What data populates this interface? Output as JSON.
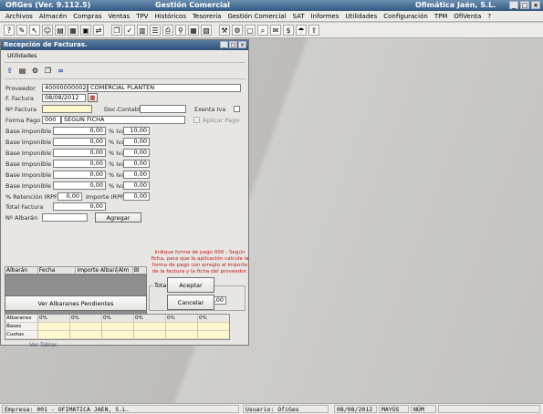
{
  "app": {
    "title": "OfiGes (Ver. 9.112.5)",
    "module": "Gestión Comercial",
    "company": "Ofimática Jaén, S.L."
  },
  "menu": [
    "Archivos",
    "Almacén",
    "Compras",
    "Ventas",
    "TPV",
    "Históricos",
    "Tesorería",
    "Gestión Comercial",
    "SAT",
    "Informes",
    "Utilidades",
    "Configuración",
    "TPM",
    "OfiVenta",
    "?"
  ],
  "toolbar_icons": [
    "help-icon",
    "edit-icon",
    "pointer-icon",
    "users-icon",
    "document-icon",
    "table-icon",
    "grid-icon",
    "exchange-icon",
    "copy-icon",
    "check-icon",
    "chart-icon",
    "list-icon",
    "print-icon",
    "filter-icon",
    "calendar-icon",
    "image-icon",
    "tool-icon",
    "gear-icon",
    "window-icon",
    "search-icon",
    "note-icon",
    "cash-icon",
    "umbrella-icon",
    "export-icon"
  ],
  "window": {
    "title": "Recepción de Facturas.",
    "menu": "Utilidades",
    "labels": {
      "proveedor": "Proveedor",
      "f_factura": "F. Factura",
      "n_factura": "Nº Factura",
      "doc_contable": "Doc.Contable",
      "exenta_iva": "Exenta Iva",
      "forma_pago": "Forma Pago",
      "aplicar_pago": "Aplicar Pago",
      "base1": "Base Imponible 1",
      "base2": "Base Imponible 2",
      "base3": "Base Imponible 3",
      "base4": "Base Imponible 4",
      "base5": "Base Imponible 5",
      "base6": "Base Imponible 6",
      "pct_iva": "% Iva",
      "retencion": "% Retención IRPF",
      "importe_irpf": "Importe IRPF",
      "total_factura": "Total Factura",
      "n_albaran": "Nº Albarán",
      "total_albaranes": "Total Albaranes"
    },
    "values": {
      "proveedor_code": "40000000002",
      "proveedor_name": "COMERCIAL PLANTEN",
      "f_factura": "08/08/2012",
      "n_factura": "",
      "doc_contable": "",
      "forma_pago_code": "000",
      "forma_pago_name": "SEGUN FICHA",
      "bases": [
        "0,00",
        "0,00",
        "0,00",
        "0,00",
        "0,00",
        "0,00"
      ],
      "ivas": [
        "10,00",
        "0,00",
        "0,00",
        "0,00",
        "0,00",
        "0,00"
      ],
      "retencion": "0,00",
      "importe_irpf": "0,00",
      "total_factura": "0,00",
      "n_albaran": "",
      "total_albaranes": "0,00"
    },
    "buttons": {
      "agregar": "Agregar",
      "ver_albaranes": "Ver Albaranes Pendientes",
      "aceptar": "Aceptar",
      "cancelar": "Cancelar"
    },
    "note": "Indique forma de pago 000 - Según ficha, para que la aplicación calcule la forma de pago con arreglo al importe de la factura y la ficha del proveedor.",
    "grid_headers": [
      "Albarán",
      "Fecha",
      "Importe Albarán",
      "Alm",
      "Bl"
    ],
    "summary": {
      "header": [
        "Albaranes",
        "0%",
        "0%",
        "0%",
        "0%",
        "0%",
        "0%"
      ],
      "rows": [
        "Bases",
        "Cuotas"
      ]
    }
  },
  "statusbar": {
    "empresa": "Empresa: 001 - OFIMATICA JAEN, S.L.",
    "usuario": "Usuario: OfiGes",
    "fecha": "08/08/2012",
    "mayus": "MAYÚS",
    "num": "NÚM"
  },
  "behind_text": "Ver Tablas"
}
